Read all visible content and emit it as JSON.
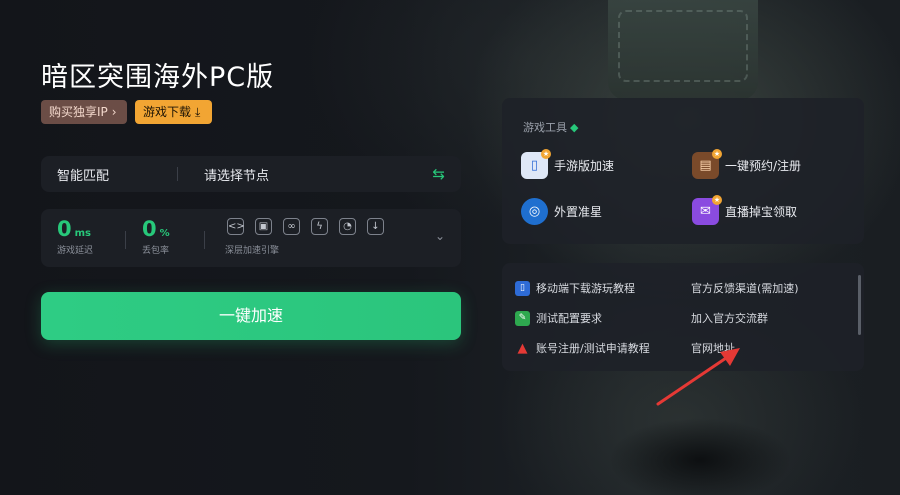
{
  "title": "暗区突围海外PC版",
  "tags": {
    "buy_ip": "购买独享IP",
    "download": "游戏下载"
  },
  "node": {
    "mode": "智能匹配",
    "select_placeholder": "请选择节点"
  },
  "stats": {
    "latency_value": "0",
    "latency_unit": "ms",
    "latency_label": "游戏延迟",
    "loss_value": "0",
    "loss_unit": "%",
    "loss_label": "丢包率",
    "deep_label": "深层加速引擎"
  },
  "boost_label": "一键加速",
  "tools": {
    "title": "游戏工具",
    "items": [
      {
        "label": "手游版加速",
        "icon": "phone-icon"
      },
      {
        "label": "一键预约/注册",
        "icon": "calendar-icon"
      },
      {
        "label": "外置准星",
        "icon": "crosshair-icon"
      },
      {
        "label": "直播掉宝领取",
        "icon": "gift-icon"
      }
    ]
  },
  "links": [
    {
      "label": "移动端下载游玩教程",
      "icon": "mobile-tutorial-icon"
    },
    {
      "label": "官方反馈渠道(需加速)"
    },
    {
      "label": "测试配置要求",
      "icon": "config-icon"
    },
    {
      "label": "加入官方交流群"
    },
    {
      "label": "账号注册/测试申请教程",
      "icon": "warning-icon"
    },
    {
      "label": "官网地址"
    }
  ],
  "colors": {
    "accent": "#27c87a",
    "orange": "#f2a533",
    "arrow": "#e53935"
  }
}
